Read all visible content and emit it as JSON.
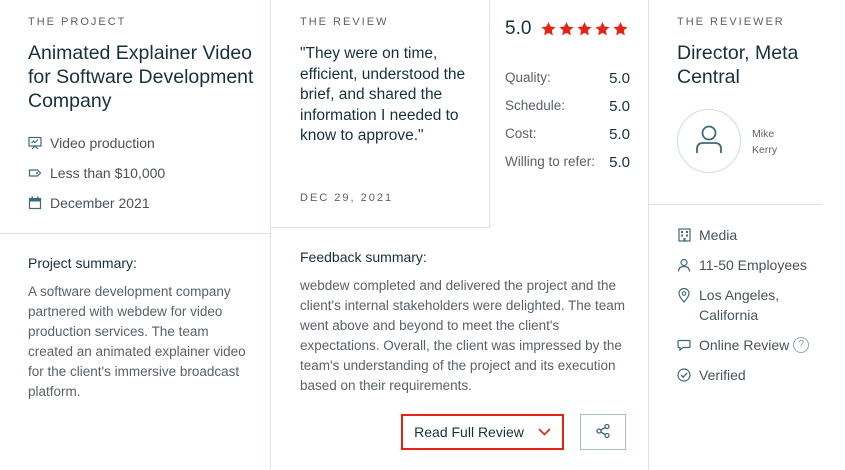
{
  "project": {
    "section_label": "THE PROJECT",
    "title": "Animated Explainer Video for Software Development Company",
    "meta": [
      {
        "icon": "video-production-icon",
        "text": "Video production"
      },
      {
        "icon": "price-tag-icon",
        "text": "Less than $10,000"
      },
      {
        "icon": "calendar-icon",
        "text": "December 2021"
      }
    ],
    "summary_heading": "Project summary:",
    "summary_text": "A software development company partnered with webdew for video production services. The team created an animated explainer video for the client's immersive broadcast platform."
  },
  "review": {
    "section_label": "THE REVIEW",
    "quote": "\"They were on time, efficient, understood the brief, and shared the information I needed to know to approve.\"",
    "date": "DEC 29, 2021",
    "feedback_heading": "Feedback summary:",
    "feedback_text": "webdew completed and delivered the project and the client's internal stakeholders were delighted. The team went above and beyond to meet the client's expectations. Overall, the client was impressed by the team's understanding of the project and its execution based on their requirements.",
    "read_full_label": "Read Full Review"
  },
  "ratings": {
    "overall": "5.0",
    "stars": 5,
    "star_color": "#e62415",
    "rows": [
      {
        "label": "Quality:",
        "value": "5.0"
      },
      {
        "label": "Schedule:",
        "value": "5.0"
      },
      {
        "label": "Cost:",
        "value": "5.0"
      },
      {
        "label": "Willing to refer:",
        "value": "5.0"
      }
    ]
  },
  "reviewer": {
    "section_label": "THE REVIEWER",
    "title": "Director, Meta Central",
    "name_line1": "Mike",
    "name_line2": "Kerry",
    "info": [
      {
        "icon": "building-icon",
        "text": "Media"
      },
      {
        "icon": "person-icon",
        "text": "11-50 Employees"
      },
      {
        "icon": "location-pin-icon",
        "text": "Los Angeles, California"
      },
      {
        "icon": "chat-bubble-icon",
        "text": "Online Review"
      },
      {
        "icon": "verified-check-icon",
        "text": "Verified"
      }
    ],
    "help_glyph": "?"
  },
  "colors": {
    "accent_red": "#e62415",
    "heading": "#17313b",
    "body_text": "#5a6168",
    "divider": "#d8e3e8"
  }
}
